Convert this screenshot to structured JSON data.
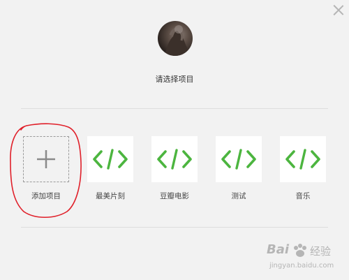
{
  "dialog": {
    "close_icon": "close-icon",
    "prompt": "请选择项目"
  },
  "projects": [
    {
      "label": "添加项目",
      "icon": "plus-icon"
    },
    {
      "label": "最美片刻",
      "icon": "code-icon"
    },
    {
      "label": "豆瓣电影",
      "icon": "code-icon"
    },
    {
      "label": "测试",
      "icon": "code-icon"
    },
    {
      "label": "音乐",
      "icon": "code-icon"
    }
  ],
  "colors": {
    "code_icon": "#4cb53f",
    "annotation": "#e0202a"
  },
  "watermark": {
    "brand_left": "Bai",
    "brand_right": "经验",
    "url": "jingyan.baidu.com"
  }
}
